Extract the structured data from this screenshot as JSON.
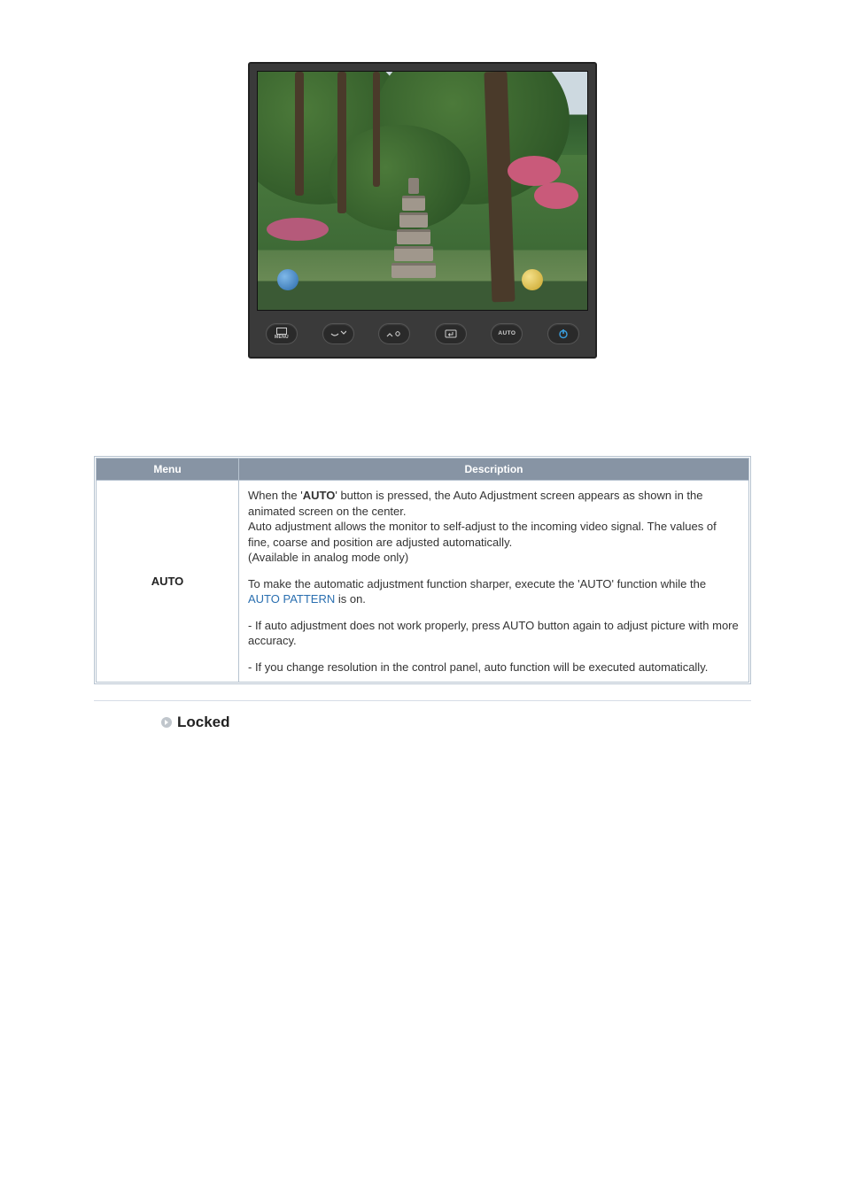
{
  "monitor": {
    "buttons": {
      "menu": "MENU",
      "auto": "AUTO"
    }
  },
  "table": {
    "headers": {
      "menu": "Menu",
      "description": "Description"
    },
    "row": {
      "menu": "AUTO",
      "p1_a": "When the '",
      "p1_bold": "AUTO",
      "p1_b": "' button is pressed, the Auto Adjustment screen appears as shown in the animated screen on the center.",
      "p1_c": "Auto adjustment allows the monitor to self-adjust to the incoming video signal. The values of fine, coarse and position are adjusted automatically.",
      "p1_d": "(Available in analog mode only)",
      "p2_a": "To make the automatic adjustment function sharper, execute the 'AUTO' function while the ",
      "p2_link": "AUTO PATTERN",
      "p2_b": " is on.",
      "p3": "- If auto adjustment does not work properly, press AUTO button again to adjust picture with more accuracy.",
      "p4": "- If you change resolution in the control panel, auto function will be executed automatically."
    }
  },
  "locked": {
    "label": "Locked"
  }
}
